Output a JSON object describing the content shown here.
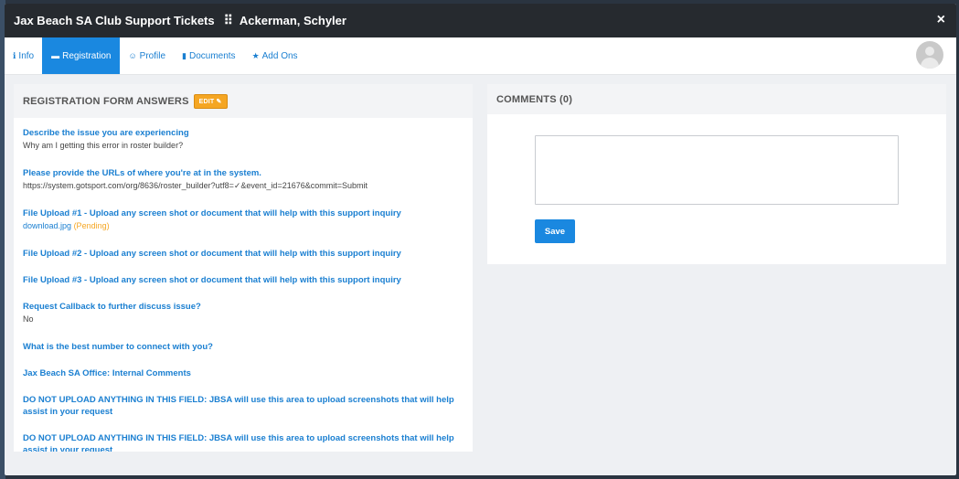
{
  "header": {
    "title": "Jax Beach SA Club Support Tickets",
    "separator": "⠿",
    "user": "Ackerman, Schyler",
    "close": "×"
  },
  "tabs": [
    {
      "icon": "ℹ",
      "label": "Info"
    },
    {
      "icon": "▬",
      "label": "Registration"
    },
    {
      "icon": "☺",
      "label": "Profile"
    },
    {
      "icon": "▮",
      "label": "Documents"
    },
    {
      "icon": "★",
      "label": "Add Ons"
    }
  ],
  "registration": {
    "title": "REGISTRATION FORM ANSWERS",
    "edit_label": "EDIT ✎",
    "items": [
      {
        "q": "Describe the issue you are experiencing",
        "a": "Why am I getting this error in roster builder?"
      },
      {
        "q": "Please provide the URLs of where you're at in the system.",
        "a": "https://system.gotsport.com/org/8636/roster_builder?utf8=✓&event_id=21676&commit=Submit"
      },
      {
        "q": "File Upload #1 - Upload any screen shot or document that will help with this support inquiry",
        "file": "download.jpg",
        "status": "(Pending)"
      },
      {
        "q": "File Upload #2 - Upload any screen shot or document that will help with this support inquiry"
      },
      {
        "q": "File Upload #3 - Upload any screen shot or document that will help with this support inquiry"
      },
      {
        "q": "Request Callback to further discuss issue?",
        "a": "No"
      },
      {
        "q": "What is the best number to connect with you?"
      },
      {
        "q": "Jax Beach SA Office: Internal Comments"
      },
      {
        "q": "DO NOT UPLOAD ANYTHING IN THIS FIELD: JBSA will use this area to upload screenshots that will help assist in your request"
      },
      {
        "q": "DO NOT UPLOAD ANYTHING IN THIS FIELD: JBSA will use this area to upload screenshots that will help assist in your request"
      }
    ]
  },
  "comments": {
    "title": "COMMENTS (0)",
    "save_label": "Save",
    "value": ""
  },
  "colors": {
    "accent": "#1a88e0",
    "header_bg": "#262a2f",
    "edit": "#f5a623"
  }
}
